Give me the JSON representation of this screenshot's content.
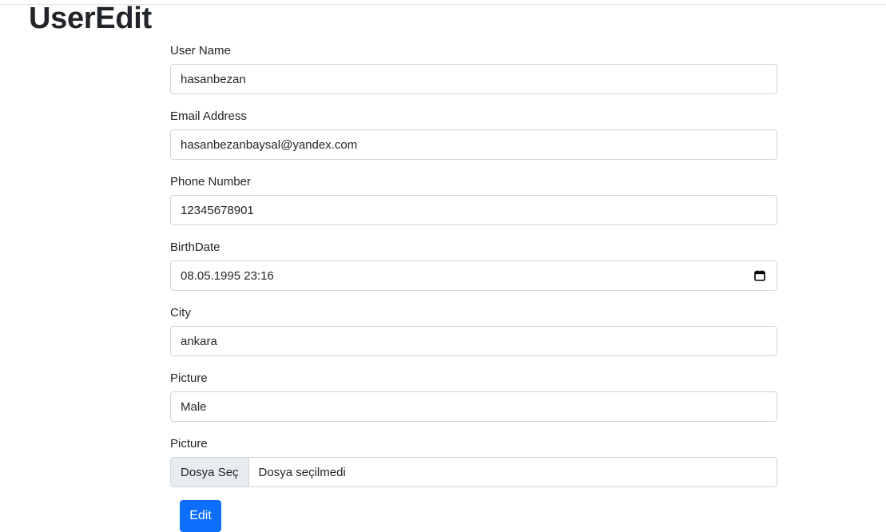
{
  "page": {
    "title": "UserEdit"
  },
  "form": {
    "fields": [
      {
        "label": "User Name",
        "value": "hasanbezan"
      },
      {
        "label": "Email Address",
        "value": "hasanbezanbaysal@yandex.com"
      },
      {
        "label": "Phone Number",
        "value": "12345678901"
      },
      {
        "label": "BirthDate",
        "value": "08.05.1995 23:16",
        "icon": "calendar-icon"
      },
      {
        "label": "City",
        "value": "ankara"
      },
      {
        "label": "Picture",
        "value": "Male"
      }
    ],
    "file": {
      "label": "Picture",
      "button_label": "Dosya Seç",
      "status_text": "Dosya seçilmedi"
    },
    "submit_label": "Edit"
  },
  "colors": {
    "primary": "#0d6efd",
    "border": "#ced4da",
    "file_button_bg": "#e9ecef",
    "text": "#212529"
  }
}
